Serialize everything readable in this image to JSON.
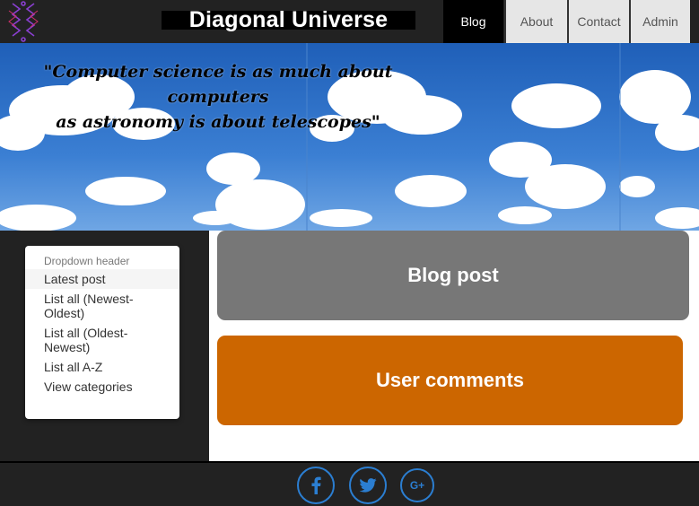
{
  "header": {
    "title": "Diagonal Universe",
    "logo_icon": "circuit-logo-icon",
    "nav": {
      "blog": "Blog",
      "about": "About",
      "contact": "Contact",
      "admin": "Admin"
    }
  },
  "banner": {
    "quote_line1": "\"Computer science is as much about computers",
    "quote_line2": "as astronomy is about telescopes\""
  },
  "sidebar": {
    "dropdown_header": "Dropdown header",
    "items": [
      "Latest post",
      "List all (Newest-Oldest)",
      "List all (Oldest-Newest)",
      "List all A-Z",
      "View categories"
    ]
  },
  "main": {
    "blog_post": "Blog post",
    "user_comments": "User comments"
  },
  "footer": {
    "social": [
      "facebook-icon",
      "twitter-icon",
      "google-plus-icon"
    ],
    "google_plus_label": "G+"
  },
  "colors": {
    "header_bg": "#222222",
    "blog_panel": "#777777",
    "comments_panel": "#cc6600",
    "social_accent": "#2b7ed1"
  }
}
